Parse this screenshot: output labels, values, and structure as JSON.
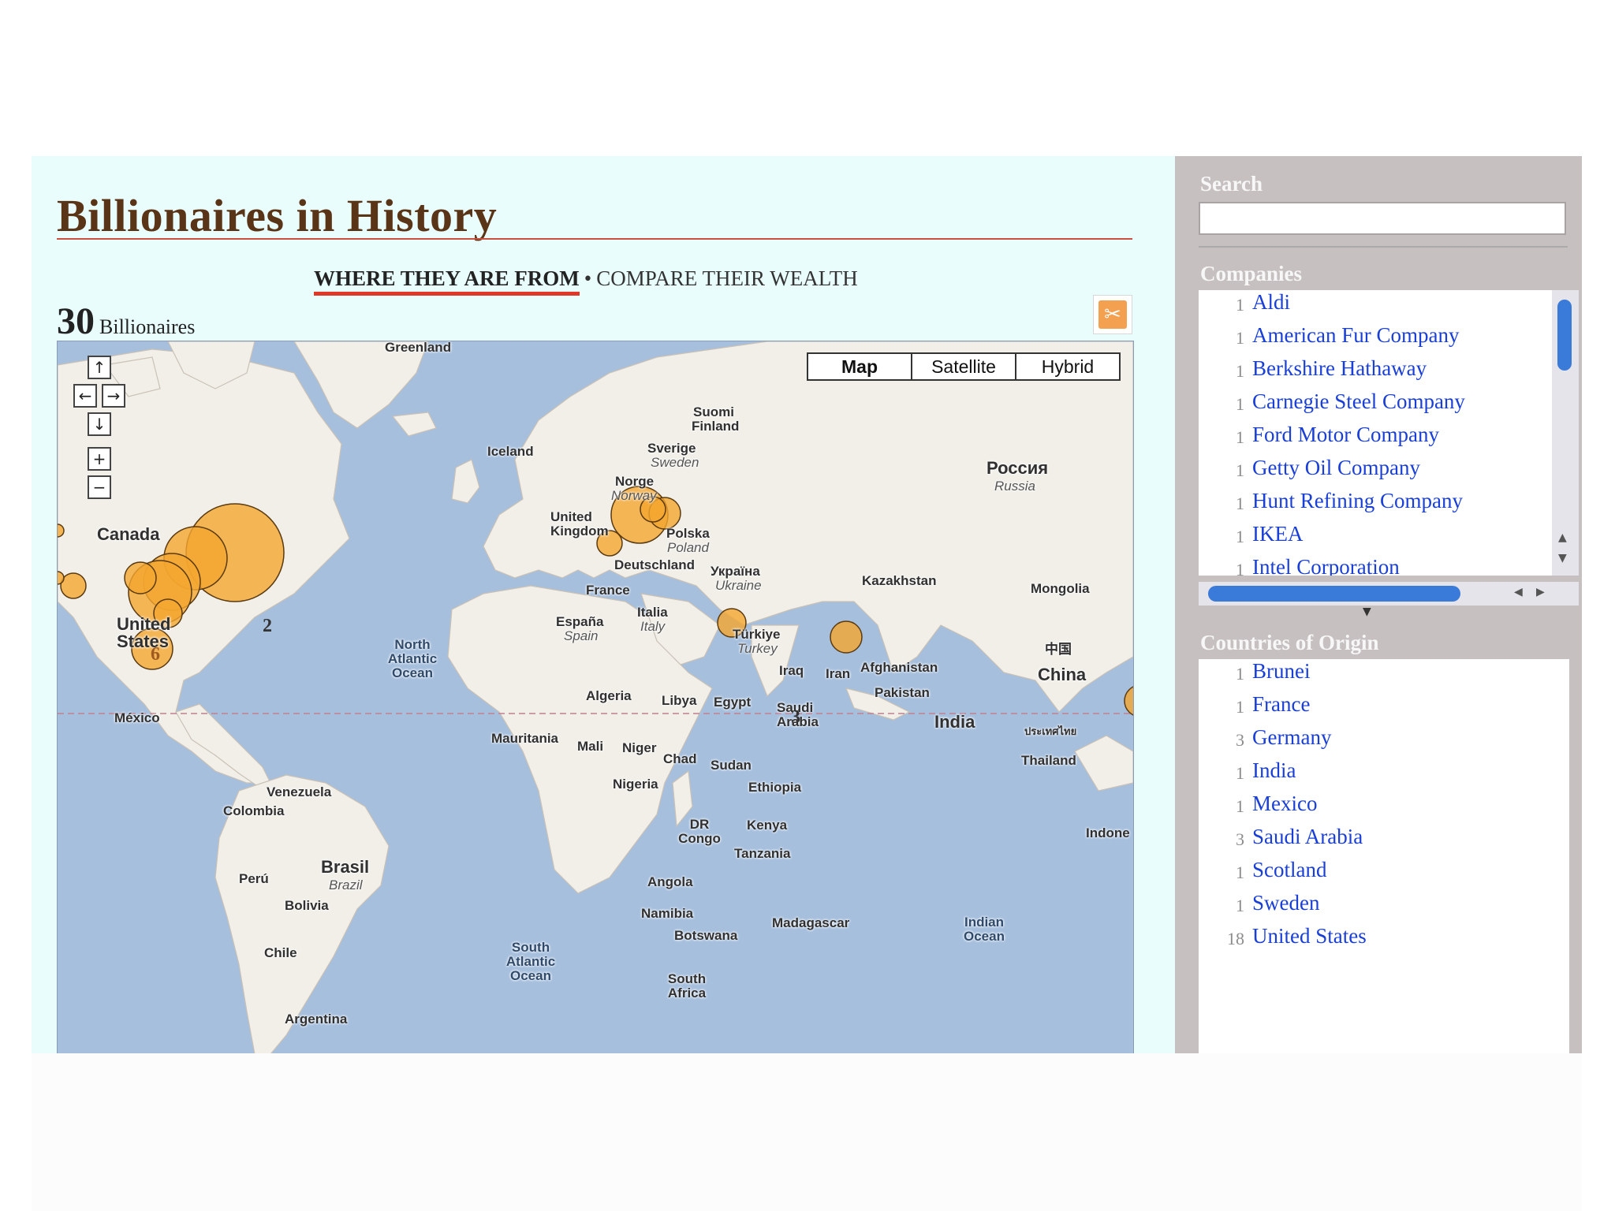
{
  "header": {
    "title": "Billionaires in History",
    "nav": {
      "active": "WHERE THEY ARE FROM",
      "separator": "•",
      "other": "COMPARE THEIR WEALTH"
    },
    "count_value": "30",
    "count_label": "Billionaires"
  },
  "map": {
    "type_buttons": [
      "Map",
      "Satellite",
      "Hybrid"
    ],
    "selected_type": "Map",
    "controls": {
      "up": "↑",
      "left": "←",
      "right": "→",
      "down": "↓",
      "zoom_in": "+",
      "zoom_out": "−"
    },
    "labels": {
      "greenland": "Greenland",
      "iceland": "Iceland",
      "canada": "Canada",
      "united_states": "United States",
      "mexico": "México",
      "venezuela": "Venezuela",
      "colombia": "Colombia",
      "brasil": "Brasil",
      "brazil": "Brazil",
      "peru": "Perú",
      "bolivia": "Bolivia",
      "chile": "Chile",
      "argentina": "Argentina",
      "north_atlantic": "North Atlantic Ocean",
      "south_atlantic": "South Atlantic Ocean",
      "indian_ocean": "Indian Ocean",
      "suomi": "Suomi",
      "finland": "Finland",
      "sverige": "Sverige",
      "sweden": "Sweden",
      "norge": "Norge",
      "norway": "Norway",
      "uk": "United Kingdom",
      "polska": "Polska",
      "poland": "Poland",
      "germany": "Deutschland",
      "france": "France",
      "espana": "España",
      "spain": "Spain",
      "italia": "Italia",
      "italy": "Italy",
      "ukraina": "Україна",
      "ukraine": "Ukraine",
      "turkiye": "Türkiye",
      "turkey": "Turkey",
      "rossiya": "Россия",
      "russia": "Russia",
      "kazakhstan": "Kazakhstan",
      "mongolia": "Mongolia",
      "china_zh": "中国",
      "china": "China",
      "iraq": "Iraq",
      "iran": "Iran",
      "afghanistan": "Afghanistan",
      "pakistan": "Pakistan",
      "india": "India",
      "thailand_th": "ประเทศไทย",
      "thailand": "Thailand",
      "indonesia": "Indone",
      "algeria": "Algeria",
      "libya": "Libya",
      "egypt": "Egypt",
      "saudi": "Saudi Arabia",
      "mauritania": "Mauritania",
      "mali": "Mali",
      "niger": "Niger",
      "chad": "Chad",
      "sudan": "Sudan",
      "nigeria": "Nigeria",
      "ethiopia": "Ethiopia",
      "kenya": "Kenya",
      "dr_congo": "DR Congo",
      "tanzania": "Tanzania",
      "angola": "Angola",
      "namibia": "Namibia",
      "botswana": "Botswana",
      "madagascar": "Madagascar",
      "south_africa": "South Africa"
    },
    "cluster_labels": {
      "usa_east": "2",
      "usa_south": "6",
      "saudi": "3"
    },
    "colors": {
      "water": "#a6bfdd",
      "land": "#f2efe9",
      "marker": "#f4a630",
      "equator": "#c08090"
    }
  },
  "sidebar": {
    "search_label": "Search",
    "search_value": "",
    "companies_label": "Companies",
    "companies": [
      {
        "count": "1",
        "name": "Aldi"
      },
      {
        "count": "1",
        "name": "American Fur Company"
      },
      {
        "count": "1",
        "name": "Berkshire Hathaway"
      },
      {
        "count": "1",
        "name": "Carnegie Steel Company"
      },
      {
        "count": "1",
        "name": "Ford Motor Company"
      },
      {
        "count": "1",
        "name": "Getty Oil Company"
      },
      {
        "count": "1",
        "name": "Hunt Refining Company"
      },
      {
        "count": "1",
        "name": "IKEA"
      },
      {
        "count": "1",
        "name": "Intel Corporation"
      }
    ],
    "countries_label": "Countries of Origin",
    "countries": [
      {
        "count": "1",
        "name": "Brunei"
      },
      {
        "count": "1",
        "name": "France"
      },
      {
        "count": "3",
        "name": "Germany"
      },
      {
        "count": "1",
        "name": "India"
      },
      {
        "count": "1",
        "name": "Mexico"
      },
      {
        "count": "3",
        "name": "Saudi Arabia"
      },
      {
        "count": "1",
        "name": "Scotland"
      },
      {
        "count": "1",
        "name": "Sweden"
      },
      {
        "count": "18",
        "name": "United States"
      }
    ]
  }
}
